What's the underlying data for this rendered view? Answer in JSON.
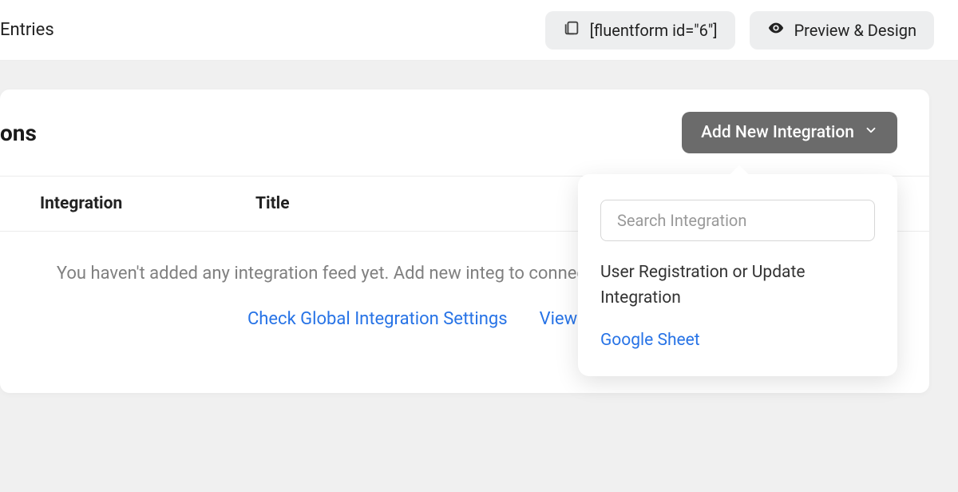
{
  "topbar": {
    "tab_entries": "Entries",
    "shortcode": "[fluentform id=\"6\"]",
    "preview_label": "Preview & Design"
  },
  "panel": {
    "title_truncated": "ons",
    "add_button_label": "Add New Integration",
    "columns": {
      "integration": "Integration",
      "title": "Title"
    },
    "empty": {
      "line": "You haven't added any integration feed yet. Add new integ to connect your favourite tools with your forms",
      "link_check": "Check Global Integration Settings",
      "link_docs": "View Documentati"
    }
  },
  "dropdown": {
    "search_placeholder": "Search Integration",
    "items": [
      "User Registration or Update Integration",
      "Google Sheet"
    ]
  }
}
